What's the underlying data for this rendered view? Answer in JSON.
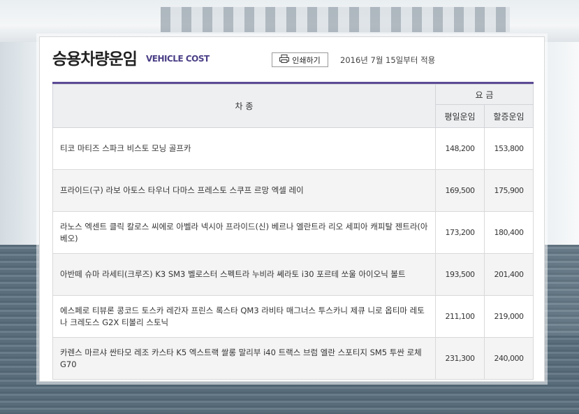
{
  "header": {
    "title": "승용차량운임",
    "subtitle": "VEHICLE COST",
    "print_label": "인쇄하기",
    "date_note": "2016년 7월 15일부터 적용"
  },
  "table": {
    "col_type": "차 종",
    "col_fare_group": "요 금",
    "col_weekday": "평일운임",
    "col_surcharge": "할증운임",
    "rows": [
      {
        "models": "티코 마티즈 스파크 비스토 모닝 골프카",
        "weekday": "148,200",
        "surcharge": "153,800"
      },
      {
        "models": "프라이드(구) 라보 아토스 타우너 다마스 프레스토 스쿠프 르망 엑셀 레이",
        "weekday": "169,500",
        "surcharge": "175,900"
      },
      {
        "models": "라노스 엑센트 클릭 칼로스 씨에로 아벨라 넥시아 프라이드(신) 베르나 엘란트라 리오 세피아 캐피탈 젠트라(아베오)",
        "weekday": "173,200",
        "surcharge": "180,400"
      },
      {
        "models": "아반떼 슈마 라세티(크루즈) K3 SM3 벨로스터 스펙트라 누비라 쎄라토 i30 포르테 쏘울 아이오닉 볼트",
        "weekday": "193,500",
        "surcharge": "201,400"
      },
      {
        "models": "에스페로 티뷰론 콩코드 토스카 레간자 프린스 록스타 QM3 라비타 매그너스 투스카니 제큐 니로 옵티마 레토나 크레도스 G2X 티볼리 스토닉",
        "weekday": "211,100",
        "surcharge": "219,000"
      },
      {
        "models": "카렌스 마르샤 싼타모 레조 카스타 K5 엑스트랙 쌀롱 말리부 i40 트랙스 브럼 엘란 스포티지 SM5 투싼 로체 G70",
        "weekday": "231,300",
        "surcharge": "240,000"
      }
    ]
  },
  "colors": {
    "accent": "#5c4b96",
    "header_bg": "#eeeff1",
    "alt_row_bg": "#f4f4f4"
  },
  "icons": {
    "print": "printer-icon"
  }
}
